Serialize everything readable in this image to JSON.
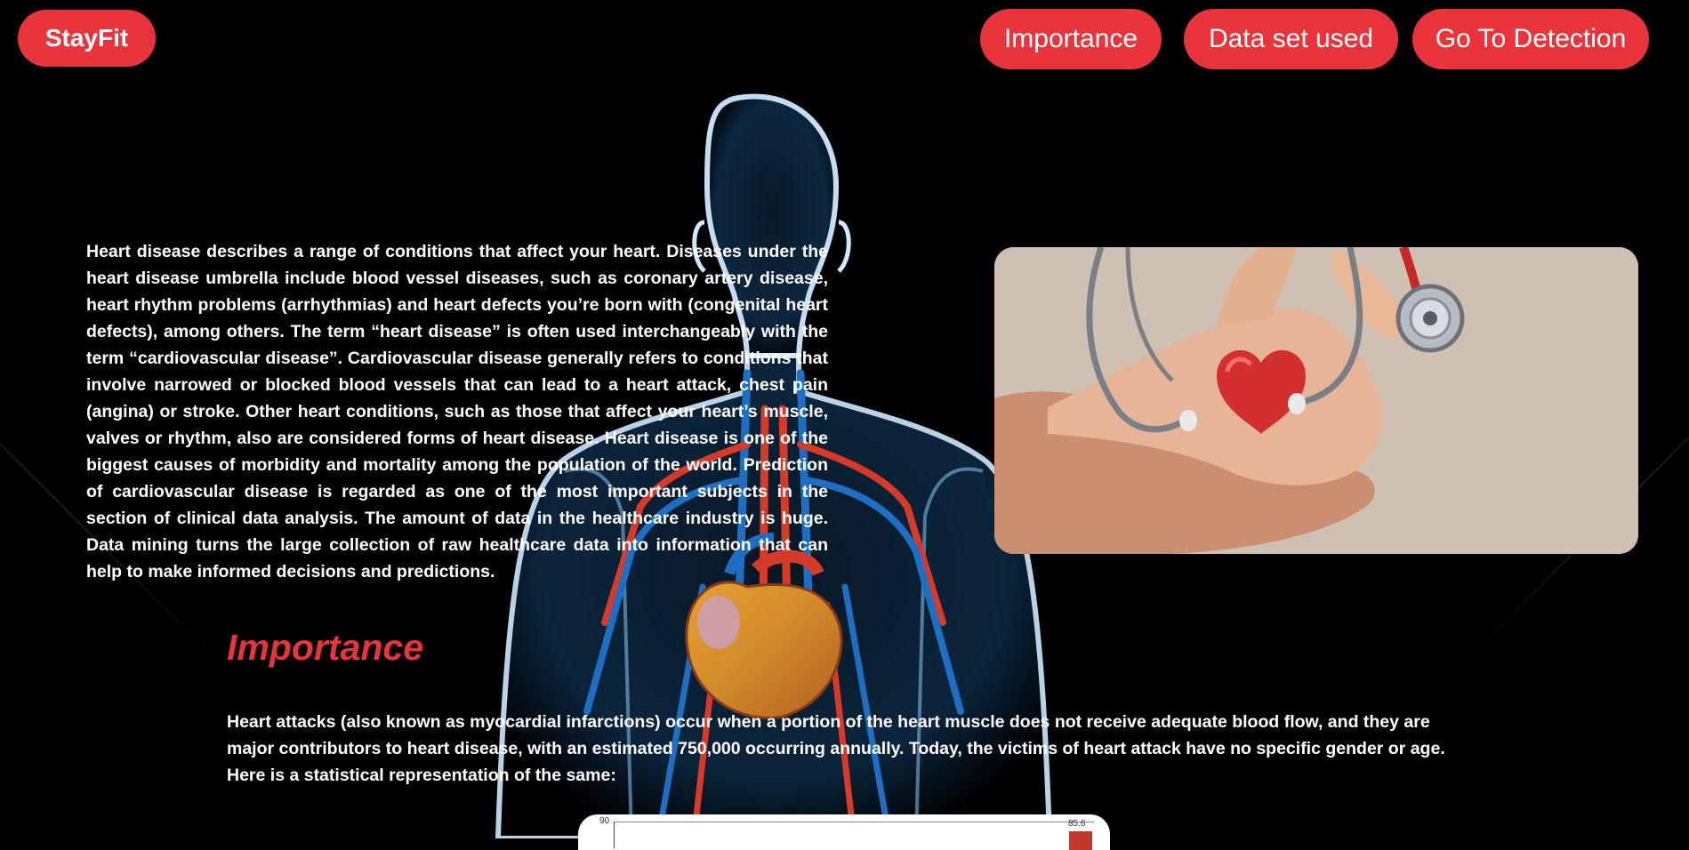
{
  "nav": {
    "brand": "StayFit",
    "links": [
      "Importance",
      "Data set used",
      "Go To Detection"
    ]
  },
  "intro": {
    "paragraph": "Heart disease describes a range of conditions that affect your heart. Diseases under the heart disease umbrella include blood vessel diseases, such as coronary artery disease, heart rhythm problems (arrhythmias) and heart defects you’re born with (congenital heart defects), among others. The term “heart disease” is often used interchangeably with the term “cardiovascular disease”. Cardiovascular disease generally refers to conditions that involve narrowed or blocked blood vessels that can lead to a heart attack, chest pain (angina) or stroke. Other heart conditions, such as those that affect your heart’s muscle, valves or rhythm, also are considered forms of heart disease. Heart disease is one of the biggest causes of morbidity and mortality among the population of the world. Prediction of cardiovascular disease is regarded as one of the most important subjects in the section of clinical data analysis. The amount of data in the healthcare industry is huge. Data mining turns the large collection of raw healthcare data into information that can help to make informed decisions and predictions."
  },
  "importance": {
    "title": "Importance",
    "paragraph": "Heart attacks (also known as myocardial infarctions) occur when a portion of the heart muscle does not receive adequate blood flow, and they are major contributors to heart disease, with an estimated 750,000 occurring annually. Today, the victims of heart attack have no specific gender or age. Here is a statistical representation of the same:"
  },
  "chart_preview": {
    "y_tick_top": "90",
    "visible_bar_label": "85.6"
  },
  "colors": {
    "accent": "#e8343a",
    "background": "#000000",
    "text": "#ffffff"
  },
  "icons": {
    "hero_image": "hands-holding-heart-stethoscope-image",
    "background": "human-body-circulatory-illustration"
  }
}
